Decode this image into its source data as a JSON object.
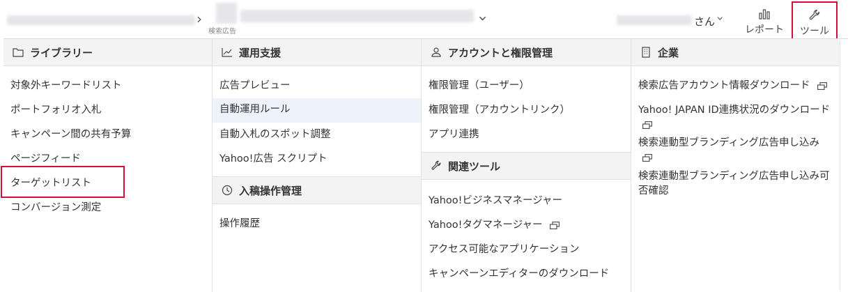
{
  "header": {
    "sub_label": "検索広告",
    "user_suffix": "さん",
    "report_label": "レポート",
    "tool_label": "ツール"
  },
  "columns": [
    {
      "title": "ライブラリー",
      "icon": "folder-icon",
      "items": [
        "対象外キーワードリスト",
        "ポートフォリオ入札",
        "キャンペーン間の共有予算",
        "ページフィード",
        "ターゲットリスト",
        "コンバージョン測定"
      ]
    },
    {
      "title": "運用支援",
      "icon": "chart-line-icon",
      "items": [
        "広告プレビュー",
        "自動運用ルール",
        "自動入札のスポット調整",
        "Yahoo!広告 スクリプト"
      ],
      "section2": {
        "title": "入稿操作管理",
        "icon": "history-icon",
        "items": [
          "操作履歴"
        ]
      }
    },
    {
      "title": "アカウントと権限管理",
      "icon": "user-icon",
      "items": [
        "権限管理（ユーザー）",
        "権限管理（アカウントリンク）",
        "アプリ連携"
      ],
      "section2": {
        "title": "関連ツール",
        "icon": "wrench-icon",
        "items": [
          "Yahoo!ビジネスマネージャー",
          "Yahoo!タグマネージャー",
          "アクセス可能なアプリケーション",
          "キャンペーンエディターのダウンロード"
        ]
      }
    },
    {
      "title": "企業",
      "icon": "building-icon",
      "items": [
        "検索広告アカウント情報ダウンロード",
        "Yahoo! JAPAN ID連携状況のダウンロード",
        "検索連動型ブランディング広告申し込み",
        "検索連動型ブランディング広告申し込み可否確認"
      ]
    }
  ],
  "colors": {
    "highlight_border": "#d0103a",
    "header_bg": "#f3f3f3",
    "selected_bg": "#eef3fb"
  }
}
